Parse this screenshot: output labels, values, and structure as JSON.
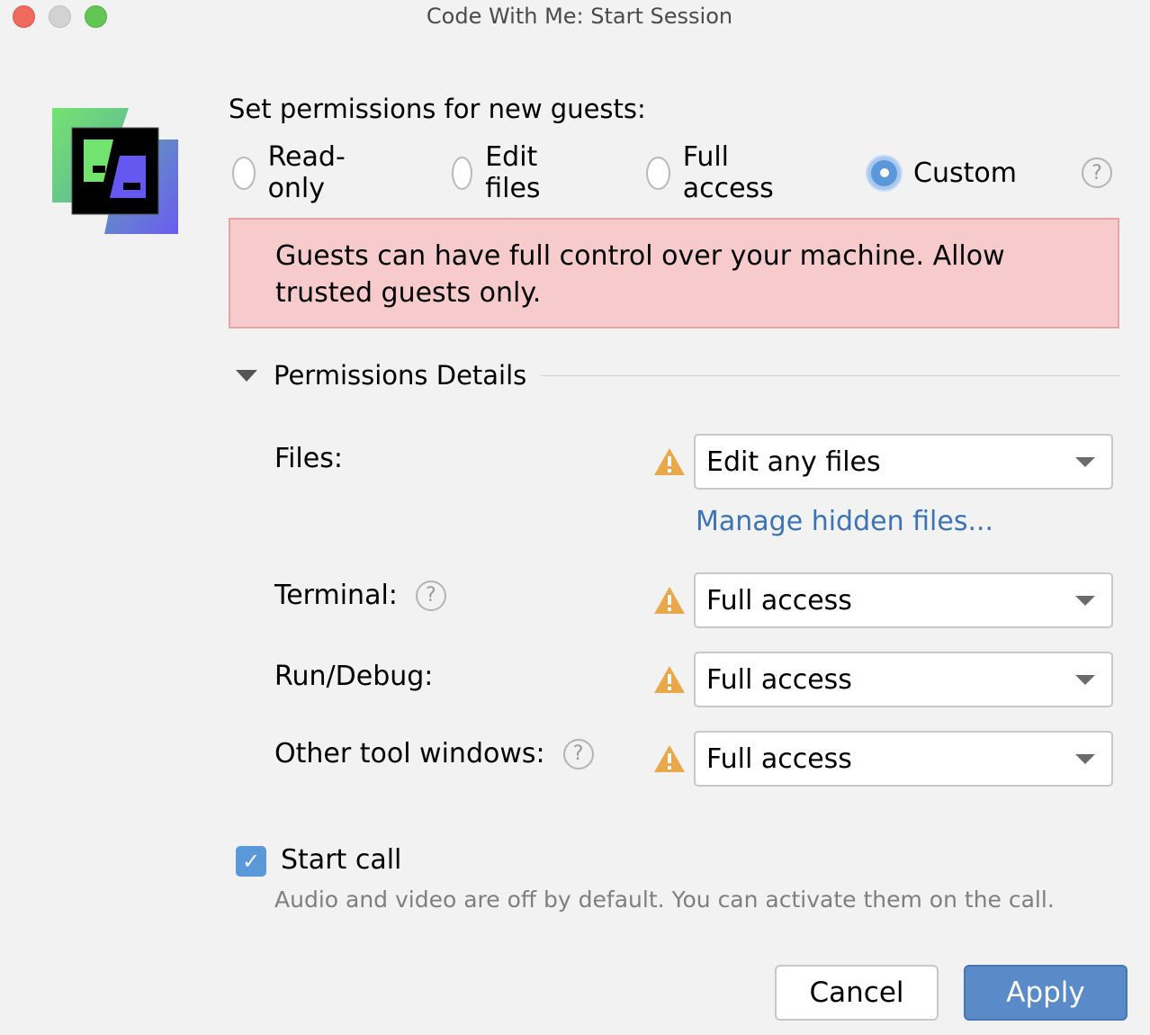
{
  "window": {
    "title": "Code With Me: Start Session",
    "traffic_lights": [
      "close",
      "minimize",
      "zoom"
    ]
  },
  "logo": {
    "icon": "code-with-me-logo",
    "colors": {
      "green": "#72e36f",
      "purple": "#6b5cf0",
      "black": "#000000"
    }
  },
  "permissions": {
    "heading": "Set permissions for new guests:",
    "options": [
      {
        "label": "Read-only",
        "selected": false
      },
      {
        "label": "Edit files",
        "selected": false
      },
      {
        "label": "Full access",
        "selected": false
      },
      {
        "label": "Custom",
        "selected": true
      }
    ],
    "help_icon": "question-mark-icon"
  },
  "alert": {
    "text": "Guests can have full control over your machine. Allow trusted guests only.",
    "background": "#f7cbcc"
  },
  "details": {
    "section_title": "Permissions Details",
    "expanded": true,
    "rows": [
      {
        "label": "Files:",
        "value": "Edit any files",
        "warning": true,
        "help": false
      },
      {
        "label": "Terminal:",
        "value": "Full access",
        "warning": true,
        "help": true
      },
      {
        "label": "Run/Debug:",
        "value": "Full access",
        "warning": true,
        "help": false
      },
      {
        "label": "Other tool windows:",
        "value": "Full access",
        "warning": true,
        "help": true
      }
    ],
    "manage_link": "Manage hidden files..."
  },
  "call": {
    "checkbox_label": "Start call",
    "checked": true,
    "hint": "Audio and video are off by default. You can activate them on the call."
  },
  "buttons": {
    "cancel": "Cancel",
    "apply": "Apply"
  },
  "colors": {
    "accent": "#5b98d9",
    "link": "#3b73b5",
    "warning": "#e9a94a"
  }
}
